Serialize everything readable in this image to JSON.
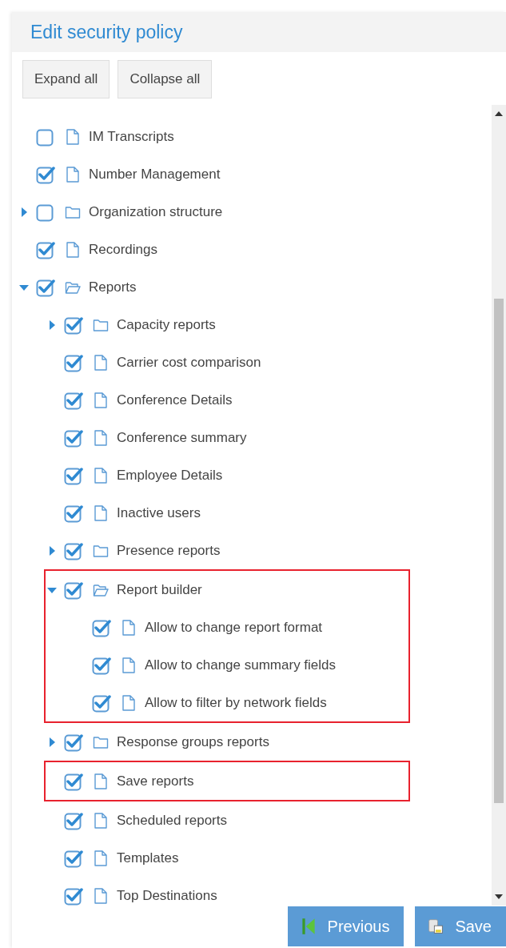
{
  "title": "Edit security policy",
  "toolbar_buttons": [
    "Expand all",
    "Collapse all"
  ],
  "tree": [
    {
      "label": "IM Transcripts",
      "kind": "file",
      "checked": false,
      "highlighted": false
    },
    {
      "label": "Number Management",
      "kind": "file",
      "checked": true,
      "highlighted": false
    },
    {
      "label": "Organization structure",
      "kind": "folder",
      "expanded": false,
      "checked": false,
      "highlighted": false
    },
    {
      "label": "Recordings",
      "kind": "file",
      "checked": true,
      "highlighted": false
    },
    {
      "label": "Reports",
      "kind": "folder",
      "expanded": true,
      "checked": true,
      "highlighted": false,
      "children": [
        {
          "label": "Capacity reports",
          "kind": "folder",
          "expanded": false,
          "checked": true,
          "highlighted": false
        },
        {
          "label": "Carrier cost comparison",
          "kind": "file",
          "checked": true,
          "highlighted": false
        },
        {
          "label": "Conference Details",
          "kind": "file",
          "checked": true,
          "highlighted": false
        },
        {
          "label": "Conference summary",
          "kind": "file",
          "checked": true,
          "highlighted": false
        },
        {
          "label": "Employee Details",
          "kind": "file",
          "checked": true,
          "highlighted": false
        },
        {
          "label": "Inactive users",
          "kind": "file",
          "checked": true,
          "highlighted": false
        },
        {
          "label": "Presence reports",
          "kind": "folder",
          "expanded": false,
          "checked": true,
          "highlighted": false
        },
        {
          "label": "Report builder",
          "kind": "folder",
          "expanded": true,
          "checked": true,
          "highlighted": true,
          "children": [
            {
              "label": "Allow to change report format",
              "kind": "file",
              "checked": true,
              "highlighted": false
            },
            {
              "label": "Allow to change summary fields",
              "kind": "file",
              "checked": true,
              "highlighted": false
            },
            {
              "label": "Allow to filter by network fields",
              "kind": "file",
              "checked": true,
              "highlighted": false
            }
          ]
        },
        {
          "label": "Response groups reports",
          "kind": "folder",
          "expanded": false,
          "checked": true,
          "highlighted": false
        },
        {
          "label": "Save reports",
          "kind": "file",
          "checked": true,
          "highlighted": true
        },
        {
          "label": "Scheduled reports",
          "kind": "file",
          "checked": true,
          "highlighted": false
        },
        {
          "label": "Templates",
          "kind": "file",
          "checked": true,
          "highlighted": false
        },
        {
          "label": "Top Destinations",
          "kind": "file",
          "checked": true,
          "highlighted": false
        }
      ]
    }
  ],
  "footer_buttons": [
    {
      "label": "Previous",
      "kind": "previous"
    },
    {
      "label": "Save",
      "kind": "save"
    }
  ]
}
